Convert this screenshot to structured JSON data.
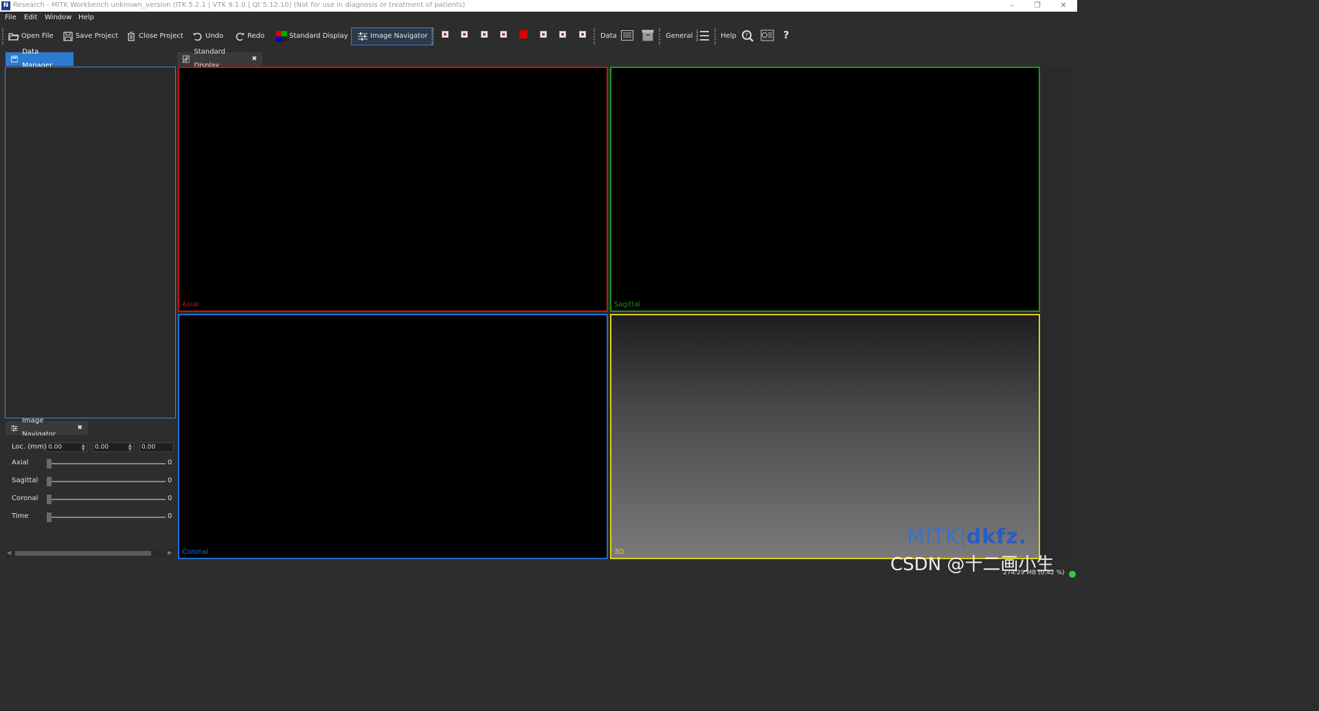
{
  "window": {
    "title": "Research - MITK Workbench unknown_version (ITK 5.2.1 | VTK 9.1.0 | Qt 5.12.10) (Not for use in diagnosis or treatment of patients)",
    "logo_letter": "N",
    "minimize": "–",
    "restore": "❐",
    "close": "✕"
  },
  "menu": [
    "File",
    "Edit",
    "Window",
    "Help"
  ],
  "toolbar": {
    "open_file": "Open File",
    "save_project": "Save Project",
    "close_project": "Close Project",
    "undo": "Undo",
    "redo": "Redo",
    "standard_display": "Standard Display",
    "image_navigator": "Image Navigator",
    "data": "Data",
    "general": "General",
    "help": "Help",
    "help_icon": "?"
  },
  "data_manager": {
    "tab_label": "Data Manager"
  },
  "image_navigator": {
    "tab_label": "Image Navigator",
    "close": "✖",
    "loc_label": "Loc. (mm)",
    "loc_values": [
      "0.00",
      "0.00",
      "0.00"
    ],
    "sliders": [
      {
        "label": "Axial",
        "value": "0"
      },
      {
        "label": "Sagittal",
        "value": "0"
      },
      {
        "label": "Coronal",
        "value": "0"
      },
      {
        "label": "Time",
        "value": "0"
      }
    ]
  },
  "display": {
    "tab_label": "Standard Display",
    "close": "✖",
    "views": {
      "axial": {
        "label": "Axial",
        "color": "#c01818"
      },
      "sagittal": {
        "label": "Sagittal",
        "color": "#1c9a1c"
      },
      "coronal": {
        "label": "Coronal",
        "color": "#1f6fd6"
      },
      "threed": {
        "label": "3D",
        "color": "#e0d21a"
      }
    },
    "brand_left": "MITK",
    "brand_right": "dkfz."
  },
  "status": {
    "memory": "274.29 MB (0.42 %)"
  },
  "watermark": "CSDN @十二画小生"
}
